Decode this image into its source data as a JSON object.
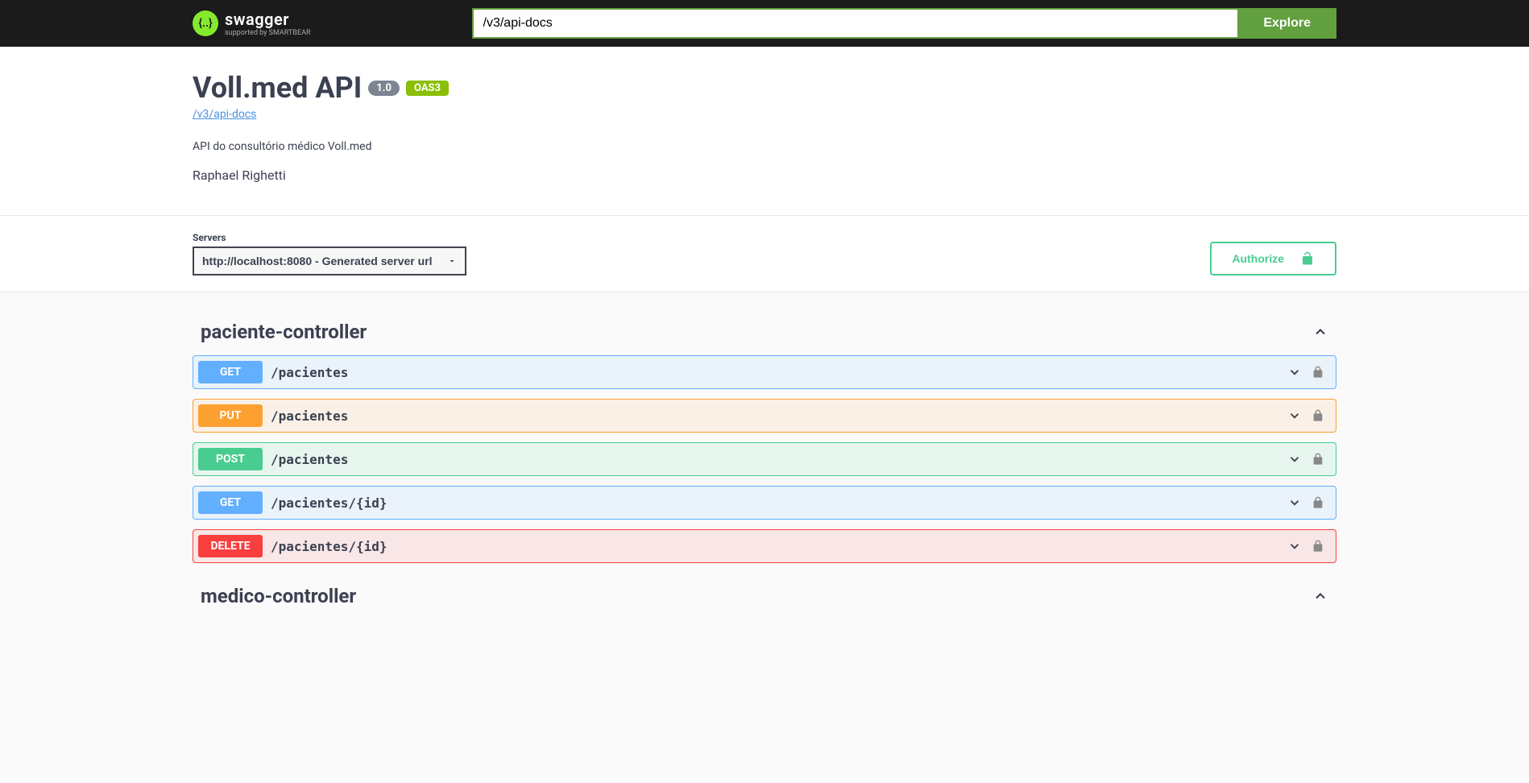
{
  "topbar": {
    "logo_main": "swagger",
    "logo_sub": "supported by SMARTBEAR",
    "search_value": "/v3/api-docs",
    "explore_label": "Explore"
  },
  "info": {
    "title": "Voll.med API",
    "version": "1.0",
    "oas_version": "OAS3",
    "docs_link": "/v3/api-docs",
    "description": "API do consultório médico Voll.med",
    "author": "Raphael Righetti"
  },
  "servers": {
    "label": "Servers",
    "selected": "http://localhost:8080 - Generated server url"
  },
  "authorize": {
    "label": "Authorize"
  },
  "tags": [
    {
      "name": "paciente-controller",
      "expanded": true,
      "operations": [
        {
          "method": "GET",
          "path": "/pacientes"
        },
        {
          "method": "PUT",
          "path": "/pacientes"
        },
        {
          "method": "POST",
          "path": "/pacientes"
        },
        {
          "method": "GET",
          "path": "/pacientes/{id}"
        },
        {
          "method": "DELETE",
          "path": "/pacientes/{id}"
        }
      ]
    },
    {
      "name": "medico-controller",
      "expanded": false,
      "operations": []
    }
  ]
}
